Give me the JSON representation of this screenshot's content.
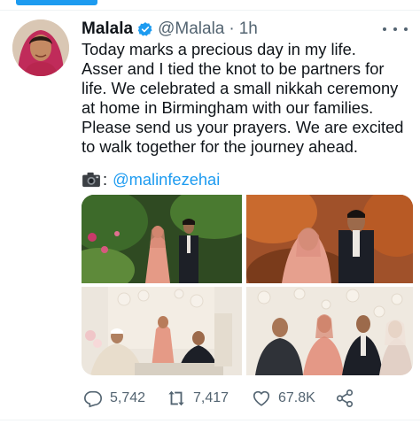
{
  "tweet": {
    "author_name": "Malala",
    "handle": "@Malala",
    "separator": "·",
    "time": "1h",
    "text_lines": [
      "Today marks a precious day in my life.",
      "Asser and I tied the knot to be partners for",
      "life. We celebrated a small nikkah ceremony",
      "at home in Birmingham with our families.",
      "Please send us your prayers. We are excited",
      "to walk together for the journey ahead."
    ],
    "photo_credit_colon": ":",
    "photo_credit_mention": "@malinfezehai"
  },
  "actions": {
    "replies": "5,742",
    "retweets": "7,417",
    "likes": "67.8K"
  },
  "colors": {
    "accent": "#1d9bf0",
    "text": "#0f1419",
    "secondary": "#536471"
  },
  "icons": [
    "verified-badge-icon",
    "more-icon",
    "camera-icon",
    "reply-icon",
    "retweet-icon",
    "like-icon",
    "share-icon"
  ]
}
